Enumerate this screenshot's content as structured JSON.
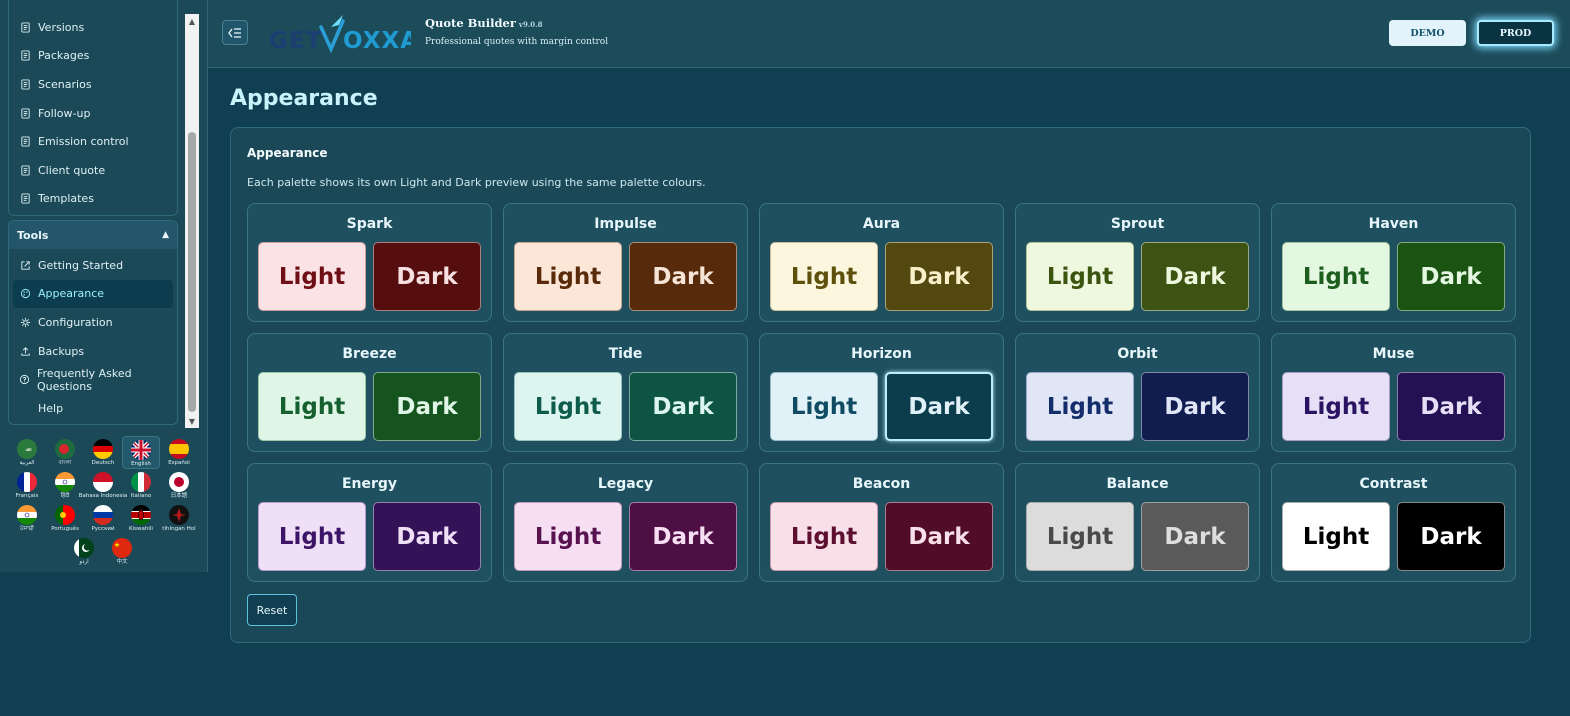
{
  "sidebar": {
    "top_items": [
      {
        "label": "Versions",
        "icon": "document-icon"
      },
      {
        "label": "Packages",
        "icon": "document-icon"
      },
      {
        "label": "Scenarios",
        "icon": "document-icon"
      },
      {
        "label": "Follow-up",
        "icon": "document-icon"
      },
      {
        "label": "Emission control",
        "icon": "document-icon"
      },
      {
        "label": "Client quote",
        "icon": "document-icon"
      },
      {
        "label": "Templates",
        "icon": "document-icon"
      }
    ],
    "tools_label": "Tools",
    "tools_items": [
      {
        "label": "Getting Started",
        "icon": "external-link-icon"
      },
      {
        "label": "Appearance",
        "icon": "palette-icon"
      },
      {
        "label": "Configuration",
        "icon": "gear-icon"
      },
      {
        "label": "Backups",
        "icon": "upload-icon"
      },
      {
        "label": "Frequently Asked Questions",
        "icon": "question-icon"
      },
      {
        "label": "Help",
        "icon": ""
      }
    ],
    "languages": [
      {
        "label": "العربية"
      },
      {
        "label": "বাংলা"
      },
      {
        "label": "Deutsch"
      },
      {
        "label": "English"
      },
      {
        "label": "Español"
      },
      {
        "label": "Français"
      },
      {
        "label": "हिंदी"
      },
      {
        "label": "Bahasa Indonesia"
      },
      {
        "label": "Italiano"
      },
      {
        "label": "日本語"
      },
      {
        "label": "ਪੰਜਾਬੀ"
      },
      {
        "label": "Português"
      },
      {
        "label": "Русский"
      },
      {
        "label": "Kiswahili"
      },
      {
        "label": "tlhIngan Hol"
      },
      {
        "label": "اردو"
      },
      {
        "label": "中文"
      }
    ]
  },
  "header": {
    "logo_text": "GETVOXXA",
    "app_title": "Quote Builder",
    "app_version": "v9.0.8",
    "app_subtitle": "Professional quotes with margin control",
    "demo_label": "DEMO",
    "prod_label": "PROD"
  },
  "main": {
    "page_title": "Appearance",
    "panel_title": "Appearance",
    "panel_description": "Each palette shows its own Light and Dark preview using the same palette colours.",
    "reset_label": "Reset",
    "light_label": "Light",
    "dark_label": "Dark",
    "palettes": [
      {
        "name": "Spark",
        "light_bg": "#fbe2e4",
        "light_fg": "#6d0f15",
        "dark_bg": "#560d0e",
        "dark_fg": "#f6dfe0"
      },
      {
        "name": "Impulse",
        "light_bg": "#fbe6d8",
        "light_fg": "#5a2b0b",
        "dark_bg": "#562a0b",
        "dark_fg": "#f6e4d6"
      },
      {
        "name": "Aura",
        "light_bg": "#fbf6dd",
        "light_fg": "#5e500b",
        "dark_bg": "#544811",
        "dark_fg": "#f8f0c9"
      },
      {
        "name": "Sprout",
        "light_bg": "#eef8de",
        "light_fg": "#3b5410",
        "dark_bg": "#3c5313",
        "dark_fg": "#eef8de"
      },
      {
        "name": "Haven",
        "light_bg": "#e3f7e1",
        "light_fg": "#1d5e1f",
        "dark_bg": "#1b5313",
        "dark_fg": "#e3f7e1"
      },
      {
        "name": "Breeze",
        "light_bg": "#dff6e6",
        "light_fg": "#15602e",
        "dark_bg": "#15531f",
        "dark_fg": "#dff6e6"
      },
      {
        "name": "Tide",
        "light_bg": "#ddf5ef",
        "light_fg": "#0f5c4d",
        "dark_bg": "#0e5443",
        "dark_fg": "#ddf5ef"
      },
      {
        "name": "Horizon",
        "light_bg": "#e0f1f7",
        "light_fg": "#0f4c63",
        "dark_bg": "#0b3d4c",
        "dark_fg": "#e0f1f7"
      },
      {
        "name": "Orbit",
        "light_bg": "#e1e6f7",
        "light_fg": "#142d6b",
        "dark_bg": "#111c4f",
        "dark_fg": "#e1e6f7"
      },
      {
        "name": "Muse",
        "light_bg": "#e6e0f7",
        "light_fg": "#2a1461",
        "dark_bg": "#231154",
        "dark_fg": "#e6e0f7"
      },
      {
        "name": "Energy",
        "light_bg": "#efe0f7",
        "light_fg": "#3d1566",
        "dark_bg": "#341257",
        "dark_fg": "#efe0f7"
      },
      {
        "name": "Legacy",
        "light_bg": "#f7dff3",
        "light_fg": "#57124f",
        "dark_bg": "#4e0f45",
        "dark_fg": "#f7dff3"
      },
      {
        "name": "Beacon",
        "light_bg": "#f9dfe8",
        "light_fg": "#5c0f2e",
        "dark_bg": "#510d28",
        "dark_fg": "#f9dfe8"
      },
      {
        "name": "Balance",
        "light_bg": "#dcdcdc",
        "light_fg": "#4a4a4a",
        "dark_bg": "#5a5a5a",
        "dark_fg": "#dedede"
      },
      {
        "name": "Contrast",
        "light_bg": "#ffffff",
        "light_fg": "#000000",
        "dark_bg": "#000000",
        "dark_fg": "#ffffff"
      }
    ]
  }
}
